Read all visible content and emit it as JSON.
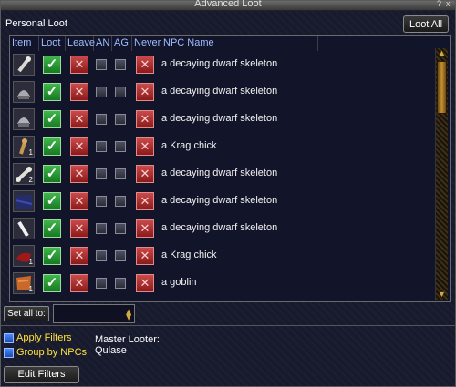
{
  "window": {
    "title": "Advanced Loot",
    "controls": [
      "?",
      "x"
    ]
  },
  "section_label": "Personal Loot",
  "loot_all_label": "Loot All",
  "columns": [
    "Item",
    "Loot",
    "Leave",
    "AN",
    "AG",
    "Never",
    "NPC Name"
  ],
  "rows": [
    {
      "npc": "a decaying dwarf skeleton",
      "icon": "bone-icon",
      "qty": ""
    },
    {
      "npc": "a decaying dwarf skeleton",
      "icon": "helm-icon",
      "qty": ""
    },
    {
      "npc": "a decaying dwarf skeleton",
      "icon": "helm-icon",
      "qty": ""
    },
    {
      "npc": "a Krag chick",
      "icon": "bone-icon",
      "qty": "1"
    },
    {
      "npc": "a decaying dwarf skeleton",
      "icon": "bone-icon",
      "qty": "2"
    },
    {
      "npc": "a decaying dwarf skeleton",
      "icon": "cloth-icon",
      "qty": ""
    },
    {
      "npc": "a decaying dwarf skeleton",
      "icon": "bone-icon",
      "qty": ""
    },
    {
      "npc": "a Krag chick",
      "icon": "meat-icon",
      "qty": "1"
    },
    {
      "npc": "a goblin",
      "icon": "hide-icon",
      "qty": "1"
    }
  ],
  "set_all_label": "Set all to:",
  "set_all_value": "",
  "filters": [
    {
      "label": "Apply Filters",
      "checked": true
    },
    {
      "label": "Group by NPCs",
      "checked": true
    }
  ],
  "master_looter_label": "Master Looter:",
  "master_looter_name": "Qulase",
  "edit_filters_label": "Edit Filters"
}
